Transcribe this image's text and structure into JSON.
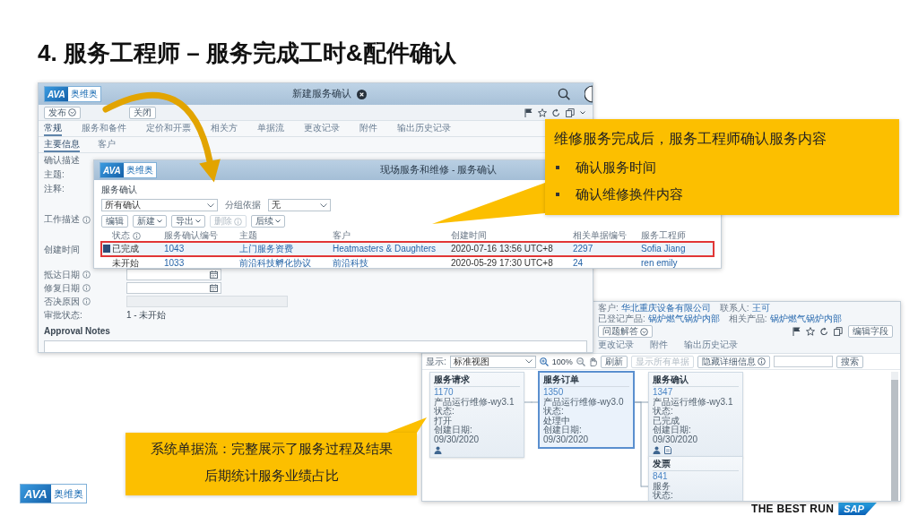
{
  "title": "4. 服务工程师 – 服务完成工时&配件确认",
  "back_window": {
    "logo": {
      "mark": "AVA",
      "name": "奥维奥"
    },
    "title": "新建服务确认",
    "toolbar_buttons": [
      {
        "label": "发布",
        "menu": true
      },
      {
        "label": "关闭",
        "menu": false
      }
    ],
    "tabs": [
      {
        "label": "常规",
        "selected": true
      },
      {
        "label": "服务和备件",
        "selected": false
      },
      {
        "label": "定价和开票",
        "selected": false
      },
      {
        "label": "相关方",
        "selected": false
      },
      {
        "label": "单据流",
        "selected": false
      },
      {
        "label": "更改记录",
        "selected": false
      },
      {
        "label": "附件",
        "selected": false
      },
      {
        "label": "输出历史记录",
        "selected": false
      }
    ],
    "subtabs": [
      {
        "label": "主要信息",
        "selected": true
      },
      {
        "label": "客户",
        "selected": false
      }
    ],
    "fields": [
      {
        "kind": "heading",
        "label": "确认描述",
        "info": false
      },
      {
        "kind": "text",
        "label": "主题:",
        "info": false
      },
      {
        "kind": "textarea",
        "label": "注释:",
        "info": false
      },
      {
        "kind": "textarea",
        "label": "工作描述",
        "info": true
      },
      {
        "kind": "datetime",
        "label": "创建时间",
        "info": false
      },
      {
        "kind": "date",
        "label": "抵达日期",
        "info": true
      },
      {
        "kind": "date",
        "label": "修复日期",
        "info": true
      },
      {
        "kind": "disabled",
        "label": "否决原因",
        "info": true
      },
      {
        "kind": "value",
        "label": "审批状态:",
        "info": false,
        "value": "1 - 未开始"
      }
    ],
    "notes_heading": "Approval Notes"
  },
  "front_window": {
    "logo": {
      "mark": "AVA",
      "name": "奥维奥"
    },
    "title": "现场服务和维修 - 服务确认",
    "section": "服务确认",
    "filter": "所有确认",
    "group_label": "分组依据",
    "group_value": "无",
    "buttons": [
      {
        "label": "编辑",
        "menu": false,
        "disabled": false
      },
      {
        "label": "新建",
        "menu": true,
        "disabled": false
      },
      {
        "label": "导出",
        "menu": true,
        "disabled": false
      },
      {
        "label": "删除",
        "menu": false,
        "disabled": true
      },
      {
        "label": "后续",
        "menu": true,
        "disabled": false
      }
    ],
    "columns": [
      {
        "label": "状态",
        "info": true,
        "link": false
      },
      {
        "label": "服务确认编号",
        "info": false,
        "link": true
      },
      {
        "label": "主题",
        "info": false,
        "link": true
      },
      {
        "label": "客户",
        "info": false,
        "link": true
      },
      {
        "label": "创建时间",
        "info": false,
        "link": false
      },
      {
        "label": "相关单据编号",
        "info": false,
        "link": true
      },
      {
        "label": "服务工程师",
        "info": false,
        "link": true
      }
    ],
    "rows": [
      {
        "selected": true,
        "highlighted": true,
        "cells": [
          "已完成",
          "1043",
          "上门服务资费",
          "Heatmasters & Daughters",
          "2020-07-16 13:56 UTC+8",
          "2297",
          "Sofia Jiang"
        ]
      },
      {
        "selected": false,
        "highlighted": false,
        "cells": [
          "未开始",
          "1033",
          "前沿科技孵化协议",
          "前沿科技",
          "2020-05-29 17:30 UTC+8",
          "24",
          "ren emily"
        ]
      }
    ]
  },
  "callout_top": {
    "title": "维修服务完成后，服务工程师确认服务内容",
    "items": [
      "确认服务时间",
      "确认维修换件内容"
    ]
  },
  "flow_window": {
    "info": [
      {
        "label": "客户:",
        "value": "华北重庆设备有限公司"
      },
      {
        "label": "联系人:",
        "value": "王可"
      },
      {
        "label": "已登记产品:",
        "value": "锅炉燃气锅炉内部"
      },
      {
        "label": "相关产品:",
        "value": "锅炉燃气锅炉内部"
      }
    ],
    "toolbar_buttons": [
      {
        "label": "问题解答",
        "menu": true
      }
    ],
    "edit_button": "编辑字段",
    "tabs": [
      {
        "label": "更改记录",
        "selected": false
      },
      {
        "label": "附件",
        "selected": false
      },
      {
        "label": "输出历史记录",
        "selected": false
      }
    ],
    "display_label": "显示:",
    "view": "标准视图",
    "zoom": "100%",
    "buttons": [
      {
        "label": "刷新",
        "disabled": false,
        "info": false
      },
      {
        "label": "显示所有单据",
        "disabled": true,
        "info": false
      },
      {
        "label": "隐藏详细信息",
        "disabled": false,
        "info": true
      }
    ],
    "search_button": "搜索",
    "nodes": [
      {
        "title": "服务请求",
        "selected": false,
        "owner": true,
        "document": false,
        "lines": [
          "1170",
          "产品运行维修-wy3.1",
          "状态:",
          "打开",
          "创建日期:",
          "09/30/2020"
        ],
        "children": [
          {
            "title": "服务订单",
            "selected": true,
            "owner": false,
            "document": false,
            "lines": [
              "1350",
              "产品运行维修-wy3.0",
              "状态:",
              "处理中",
              "创建日期:",
              "09/30/2020"
            ],
            "children": [
              {
                "title": "服务确认",
                "selected": false,
                "owner": true,
                "document": true,
                "lines": [
                  "1347",
                  "产品运行维修-wy3.1",
                  "状态:",
                  "已完成",
                  "创建日期:",
                  "09/30/2020"
                ]
              },
              {
                "title": "发票",
                "selected": false,
                "owner": false,
                "document": false,
                "lines": [
                  "841",
                  "服务",
                  "状态:"
                ]
              }
            ]
          }
        ]
      }
    ]
  },
  "callout_bottom": {
    "lines": [
      "系统单据流：完整展示了服务过程及结果",
      "后期统计服务业绩占比"
    ]
  },
  "footer": {
    "logo": {
      "mark": "AVA",
      "name": "奥维奥"
    },
    "tagline": "THE BEST RUN",
    "brand_mark": "SAP"
  }
}
